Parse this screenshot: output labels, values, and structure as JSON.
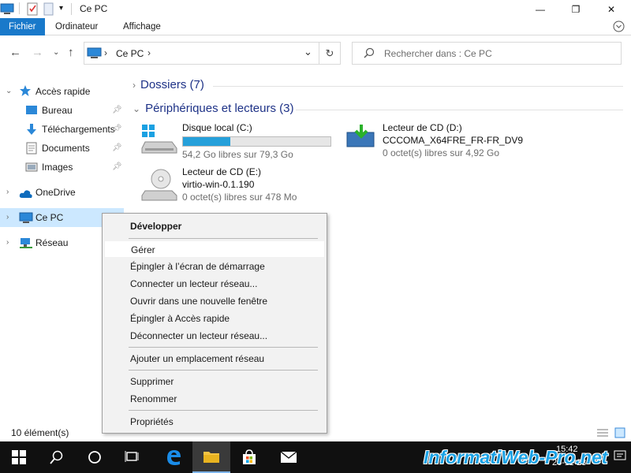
{
  "window": {
    "title": "Ce PC",
    "minimize_label": "—",
    "maximize_label": "❐",
    "close_label": "✕"
  },
  "ribbon": {
    "tabs": [
      {
        "label": "Fichier",
        "active": true
      },
      {
        "label": "Ordinateur",
        "active": false
      },
      {
        "label": "Affichage",
        "active": false
      }
    ]
  },
  "address": {
    "path_label": "Ce PC",
    "search_placeholder": "Rechercher dans : Ce PC"
  },
  "sidebar": {
    "items": [
      {
        "label": "Accès rapide",
        "icon": "star-icon"
      },
      {
        "label": "Bureau",
        "icon": "desktop-icon",
        "pinned": true
      },
      {
        "label": "Téléchargements",
        "icon": "download-icon",
        "pinned": true
      },
      {
        "label": "Documents",
        "icon": "documents-icon",
        "pinned": true
      },
      {
        "label": "Images",
        "icon": "images-icon",
        "pinned": true
      },
      {
        "label": "OneDrive",
        "icon": "cloud-icon"
      },
      {
        "label": "Ce PC",
        "icon": "computer-icon",
        "selected": true
      },
      {
        "label": "Réseau",
        "icon": "network-icon"
      }
    ]
  },
  "main": {
    "groups": [
      {
        "label": "Dossiers (7)",
        "collapsed": true
      },
      {
        "label": "Périphériques et lecteurs (3)",
        "collapsed": false
      }
    ],
    "drives": [
      {
        "name": "Disque local (C:)",
        "sub": "54,2 Go libres sur 79,3 Go",
        "used_fraction": 0.32
      },
      {
        "name": "Lecteur de CD (D:)",
        "label": "CCCOMA_X64FRE_FR-FR_DV9",
        "sub": "0 octet(s) libres sur 4,92 Go"
      },
      {
        "name": "Lecteur de CD (E:)",
        "label": "virtio-win-0.1.190",
        "sub": "0 octet(s) libres sur 478 Mo"
      }
    ]
  },
  "status": {
    "count": "10 élément(s)"
  },
  "context_menu": {
    "items": [
      {
        "label": "Développer",
        "bold": true
      },
      {
        "label": "Gérer",
        "hover": true
      },
      {
        "label": "Épingler à l’écran de démarrage"
      },
      {
        "label": "Connecter un lecteur réseau..."
      },
      {
        "label": "Ouvrir dans une nouvelle fenêtre"
      },
      {
        "label": "Épingler à Accès rapide"
      },
      {
        "label": "Déconnecter un lecteur réseau..."
      },
      {
        "label": "Ajouter un emplacement réseau"
      },
      {
        "label": "Supprimer"
      },
      {
        "label": "Renommer"
      },
      {
        "label": "Propriétés"
      }
    ]
  },
  "taskbar": {
    "time": "15:42",
    "date": "26-11-23",
    "lang": "FRA",
    "watermark": "InformatiWeb-Pro.net"
  },
  "colors": {
    "accent": "#1979ca",
    "selection": "#cce8ff",
    "progress": "#26a0da",
    "group_heading": "#1e3287"
  }
}
